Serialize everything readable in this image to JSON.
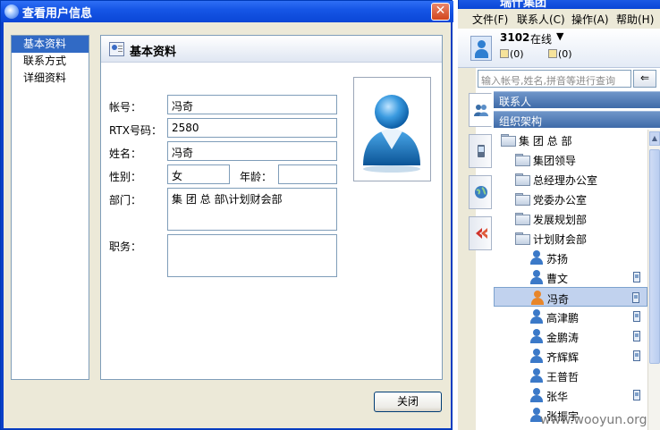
{
  "dialog": {
    "title": "查看用户信息",
    "close_glyph": "✕",
    "nav": [
      "基本资料",
      "联系方式",
      "详细资料"
    ],
    "section_title": "基本资料",
    "labels": {
      "account": "帐号：",
      "rtx": "RTX号码：",
      "name": "姓名：",
      "gender": "性别：",
      "age": "年龄：",
      "dept": "部门：",
      "title": "职务："
    },
    "values": {
      "account": "冯奇",
      "rtx": "2580",
      "name": "冯奇",
      "gender": "女",
      "age": "",
      "dept": "集 团 总 部\\计划财会部",
      "title": ""
    },
    "close_button": "关闭"
  },
  "client": {
    "title": "瑞什集团",
    "menu": [
      "文件(F)",
      "联系人(C)",
      "操作(A)",
      "帮助(H)"
    ],
    "user_id": "3102",
    "status": "在线",
    "status_arrow": "▼",
    "counter1": "(0)",
    "counter2": "(0)",
    "search_placeholder": "输入帐号,姓名,拼音等进行查询",
    "search_btn": "⇐",
    "group_contacts": "联系人",
    "group_org": "组织架构",
    "tree": [
      {
        "type": "folder",
        "text": "集 团 总 部",
        "indent": 0
      },
      {
        "type": "folder",
        "text": "集团领导",
        "indent": 1
      },
      {
        "type": "folder",
        "text": "总经理办公室",
        "indent": 1
      },
      {
        "type": "folder",
        "text": "党委办公室",
        "indent": 1
      },
      {
        "type": "folder",
        "text": "发展规划部",
        "indent": 1
      },
      {
        "type": "folder",
        "text": "计划财会部",
        "indent": 1
      },
      {
        "type": "user",
        "text": "苏扬",
        "mobile": false
      },
      {
        "type": "user",
        "text": "曹文",
        "mobile": true
      },
      {
        "type": "user",
        "text": "冯奇",
        "mobile": true,
        "selected": true
      },
      {
        "type": "user",
        "text": "高津鹏",
        "mobile": true
      },
      {
        "type": "user",
        "text": "金鹏涛",
        "mobile": true
      },
      {
        "type": "user",
        "text": "齐辉辉",
        "mobile": true
      },
      {
        "type": "user",
        "text": "王普哲",
        "mobile": false
      },
      {
        "type": "user",
        "text": "张华",
        "mobile": true
      },
      {
        "type": "user",
        "text": "张振宇",
        "mobile": false
      }
    ]
  },
  "watermark": "www.wooyun.org"
}
